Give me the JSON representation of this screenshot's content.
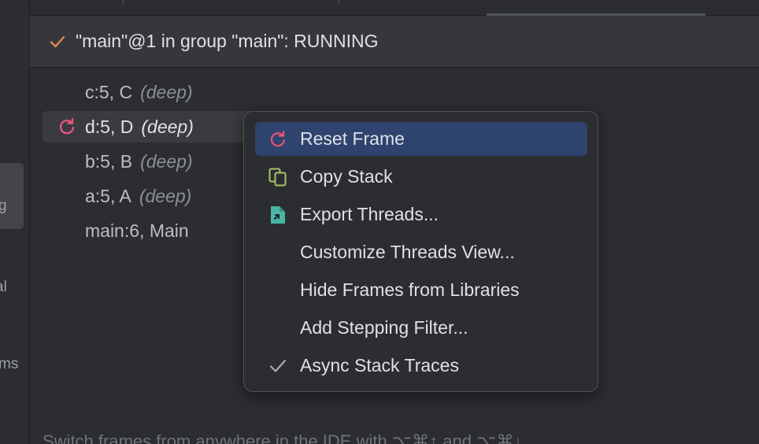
{
  "thread": {
    "status_icon": "check-icon",
    "title": "\"main\"@1 in group \"main\": RUNNING"
  },
  "sidebar_fragments": [
    "g",
    "al",
    "ms"
  ],
  "frames": [
    {
      "name": "c:5, C",
      "hint": "(deep)",
      "selected": false
    },
    {
      "name": "d:5, D",
      "hint": "(deep)",
      "selected": true,
      "icon": "reset-frame-icon"
    },
    {
      "name": "b:5, B",
      "hint": "(deep)",
      "selected": false
    },
    {
      "name": "a:5, A",
      "hint": "(deep)",
      "selected": false
    },
    {
      "name": "main:6, Main",
      "hint": "",
      "selected": false
    }
  ],
  "context_menu": {
    "items": [
      {
        "label": "Reset Frame",
        "icon": "reset-frame-icon",
        "active": true
      },
      {
        "label": "Copy Stack",
        "icon": "copy-icon"
      },
      {
        "label": "Export Threads...",
        "icon": "export-icon"
      },
      {
        "label": "Customize Threads View...",
        "icon": ""
      },
      {
        "label": "Hide Frames from Libraries",
        "icon": ""
      },
      {
        "label": "Add Stepping Filter...",
        "icon": ""
      },
      {
        "label": "Async Stack Traces",
        "icon": "checkmark-icon",
        "checked": true
      }
    ]
  },
  "footer_text": "Switch frames from anywhere in the IDE with ⌥⌘↑ and ⌥⌘↓",
  "colors": {
    "background": "#2b2d30",
    "header_bg": "#35373b",
    "menu_active": "#2e436e",
    "reset_icon": "#e5547b",
    "copy_icon": "#a7c36a",
    "export_icon": "#49b5a6",
    "check_orange": "#e08855"
  }
}
